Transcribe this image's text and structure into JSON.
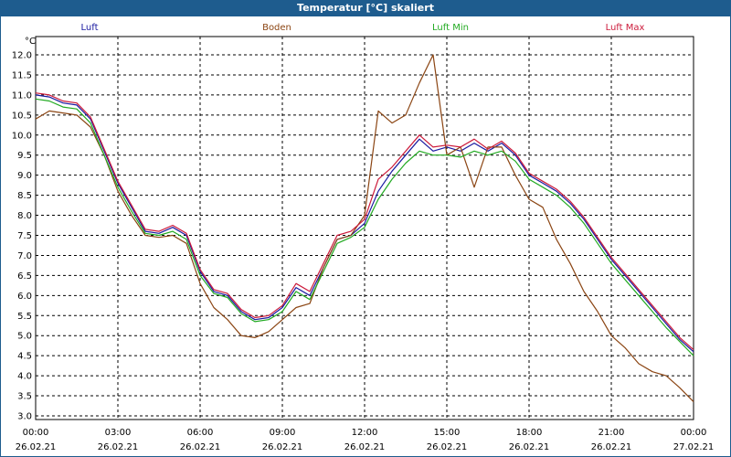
{
  "window_title": "Temperatur [°C] skaliert",
  "chart_data": {
    "type": "line",
    "title": "Temperatur [°C] skaliert",
    "ylabel": "°C",
    "xlabel": "",
    "ylim": [
      3.0,
      12.0
    ],
    "y_ticks": [
      "12.0",
      "11.5",
      "11.0",
      "10.5",
      "10.0",
      "9.5",
      "9.0",
      "8.5",
      "8.0",
      "7.5",
      "7.0",
      "6.5",
      "6.0",
      "5.5",
      "5.0",
      "4.5",
      "4.0",
      "3.5",
      "3.0"
    ],
    "x_ticks": [
      {
        "time": "00:00",
        "date": "26.02.21"
      },
      {
        "time": "03:00",
        "date": "26.02.21"
      },
      {
        "time": "06:00",
        "date": "26.02.21"
      },
      {
        "time": "09:00",
        "date": "26.02.21"
      },
      {
        "time": "12:00",
        "date": "26.02.21"
      },
      {
        "time": "15:00",
        "date": "26.02.21"
      },
      {
        "time": "18:00",
        "date": "26.02.21"
      },
      {
        "time": "21:00",
        "date": "26.02.21"
      },
      {
        "time": "00:00",
        "date": "27.02.21"
      }
    ],
    "x": [
      "00:00",
      "00:30",
      "01:00",
      "01:30",
      "02:00",
      "02:30",
      "03:00",
      "03:30",
      "04:00",
      "04:30",
      "05:00",
      "05:30",
      "06:00",
      "06:30",
      "07:00",
      "07:30",
      "08:00",
      "08:30",
      "09:00",
      "09:30",
      "10:00",
      "10:30",
      "11:00",
      "11:30",
      "12:00",
      "12:30",
      "13:00",
      "13:30",
      "14:00",
      "14:30",
      "15:00",
      "15:30",
      "16:00",
      "16:30",
      "17:00",
      "17:30",
      "18:00",
      "18:30",
      "19:00",
      "19:30",
      "20:00",
      "20:30",
      "21:00",
      "21:30",
      "22:00",
      "22:30",
      "23:00",
      "23:30",
      "00:00"
    ],
    "grid": true,
    "series": [
      {
        "name": "Luft",
        "color": "#1a1aa0",
        "values": [
          11.0,
          10.95,
          10.8,
          10.75,
          10.4,
          9.6,
          8.8,
          8.2,
          7.6,
          7.55,
          7.7,
          7.5,
          6.6,
          6.1,
          6.0,
          5.6,
          5.4,
          5.45,
          5.7,
          6.2,
          6.0,
          6.7,
          7.4,
          7.5,
          7.8,
          8.6,
          9.1,
          9.5,
          9.9,
          9.6,
          9.7,
          9.6,
          9.8,
          9.6,
          9.8,
          9.5,
          9.0,
          8.8,
          8.6,
          8.3,
          7.9,
          7.4,
          6.9,
          6.5,
          6.1,
          5.7,
          5.3,
          4.9,
          4.6
        ]
      },
      {
        "name": "Boden",
        "color": "#8b4513",
        "values": [
          10.4,
          10.6,
          10.55,
          10.5,
          10.2,
          9.5,
          8.6,
          8.0,
          7.5,
          7.45,
          7.5,
          7.3,
          6.3,
          5.7,
          5.4,
          5.0,
          4.95,
          5.1,
          5.4,
          5.7,
          5.8,
          6.7,
          7.4,
          7.5,
          8.0,
          10.6,
          10.3,
          10.5,
          11.3,
          12.0,
          9.5,
          9.7,
          8.7,
          9.7,
          9.7,
          9.0,
          8.4,
          8.2,
          7.4,
          6.8,
          6.1,
          5.6,
          5.0,
          4.7,
          4.3,
          4.1,
          4.0,
          3.7,
          3.35
        ]
      },
      {
        "name": "Luft Min",
        "color": "#22aa22",
        "values": [
          10.9,
          10.85,
          10.7,
          10.65,
          10.3,
          9.5,
          8.7,
          8.1,
          7.55,
          7.5,
          7.6,
          7.4,
          6.5,
          6.05,
          5.95,
          5.55,
          5.35,
          5.4,
          5.6,
          6.1,
          5.9,
          6.6,
          7.3,
          7.45,
          7.7,
          8.4,
          8.9,
          9.3,
          9.6,
          9.5,
          9.5,
          9.45,
          9.6,
          9.5,
          9.6,
          9.35,
          8.9,
          8.7,
          8.5,
          8.2,
          7.8,
          7.3,
          6.8,
          6.4,
          6.0,
          5.6,
          5.2,
          4.85,
          4.5
        ]
      },
      {
        "name": "Luft Max",
        "color": "#cc1a3a",
        "values": [
          11.05,
          11.0,
          10.85,
          10.8,
          10.45,
          9.65,
          8.85,
          8.25,
          7.65,
          7.6,
          7.75,
          7.55,
          6.65,
          6.15,
          6.05,
          5.65,
          5.45,
          5.5,
          5.75,
          6.3,
          6.1,
          6.8,
          7.5,
          7.6,
          7.9,
          8.9,
          9.2,
          9.6,
          10.0,
          9.7,
          9.75,
          9.7,
          9.9,
          9.65,
          9.85,
          9.55,
          9.05,
          8.85,
          8.65,
          8.35,
          7.95,
          7.45,
          6.95,
          6.55,
          6.15,
          5.75,
          5.35,
          4.95,
          4.65
        ]
      }
    ]
  }
}
